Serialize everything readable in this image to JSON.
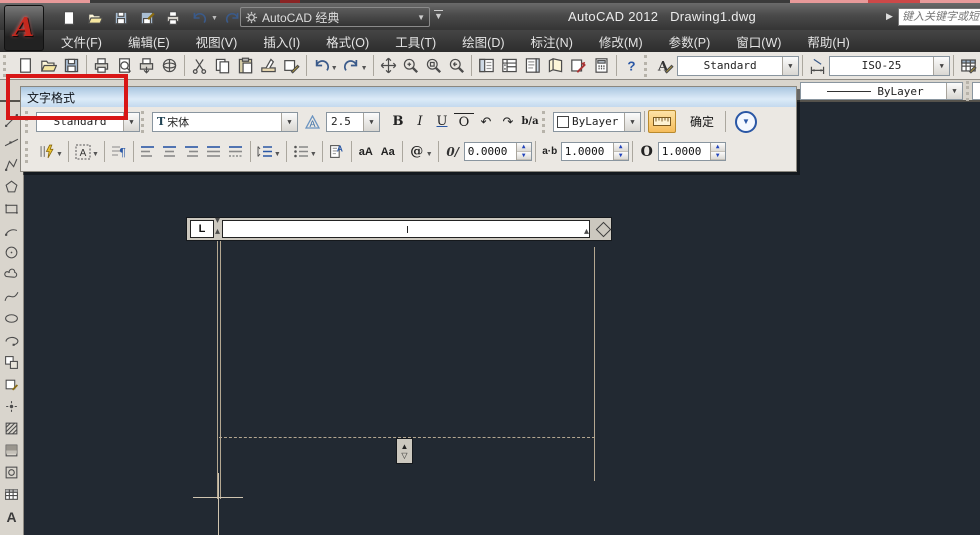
{
  "window": {
    "app_title": "AutoCAD 2012",
    "doc_title": "Drawing1.dwg",
    "title_gap": "   ",
    "logo_letter": "A",
    "workspace": "AutoCAD 经典",
    "search_placeholder": "键入关键字或短语"
  },
  "menu": {
    "items": [
      "文件(F)",
      "编辑(E)",
      "视图(V)",
      "插入(I)",
      "格式(O)",
      "工具(T)",
      "绘图(D)",
      "标注(N)",
      "修改(M)",
      "参数(P)",
      "窗口(W)",
      "帮助(H)"
    ]
  },
  "qat": {
    "icons": [
      "new",
      "open",
      "save",
      "saveas",
      "plot",
      "undo",
      "redo"
    ]
  },
  "standard_toolbar": {
    "groups": [
      [
        "new",
        "open",
        "save"
      ],
      [
        "plot",
        "preview",
        "publish",
        "globe"
      ],
      [
        "cut",
        "copy",
        "paste",
        "matchprop",
        "bedit"
      ],
      [
        "undo-drop",
        "redo-drop"
      ],
      [
        "pan",
        "zoomrt",
        "zoomwin",
        "zoomprev"
      ],
      [
        "props",
        "dcenter",
        "palettes",
        "sheetset",
        "markup",
        "calc"
      ],
      [
        "help"
      ]
    ]
  },
  "styles_toolbar": {
    "text_style_value": "Standard",
    "dim_style_value": "ISO-25"
  },
  "properties_toolbar": {
    "linetype_value": "ByLayer"
  },
  "draw_toolbar": {
    "icons": [
      "line",
      "xline",
      "pline",
      "polygon",
      "rect",
      "arc",
      "circle",
      "revcloud",
      "spline",
      "ellipse",
      "earc",
      "insblock",
      "mkblock",
      "point",
      "hatch",
      "gradient",
      "region",
      "table",
      "mtext"
    ]
  },
  "dialog": {
    "title": "文字格式",
    "style_value": "Standard",
    "font_value": "宋体",
    "font_tt": "T",
    "height_value": "2.5",
    "bold": "B",
    "italic": "I",
    "underline": "U",
    "overline": "O",
    "undo": "↶",
    "redo": "↷",
    "stack": "b/a",
    "color_value": "ByLayer",
    "ok_label": "确定",
    "options_chevron": "v",
    "paragraph_symbol": "¶",
    "uppercase": "aA",
    "lowercase": "Aa",
    "at_symbol": "@",
    "oblique_label": "0/",
    "oblique_value": "0.0000",
    "tracking_label": "a·b",
    "tracking_value": "1.0000",
    "width_label": "O",
    "width_value": "1.0000"
  },
  "editor": {
    "tab_label": "L",
    "grip_up": "▲",
    "grip_down": "▽"
  },
  "colors": {
    "highlight_red": "#d81616",
    "canvas_bg": "#222932",
    "drawing_line": "#b4a791",
    "dialog_title_blue": "#aac6e0",
    "accent_blue": "#2a57a5"
  }
}
